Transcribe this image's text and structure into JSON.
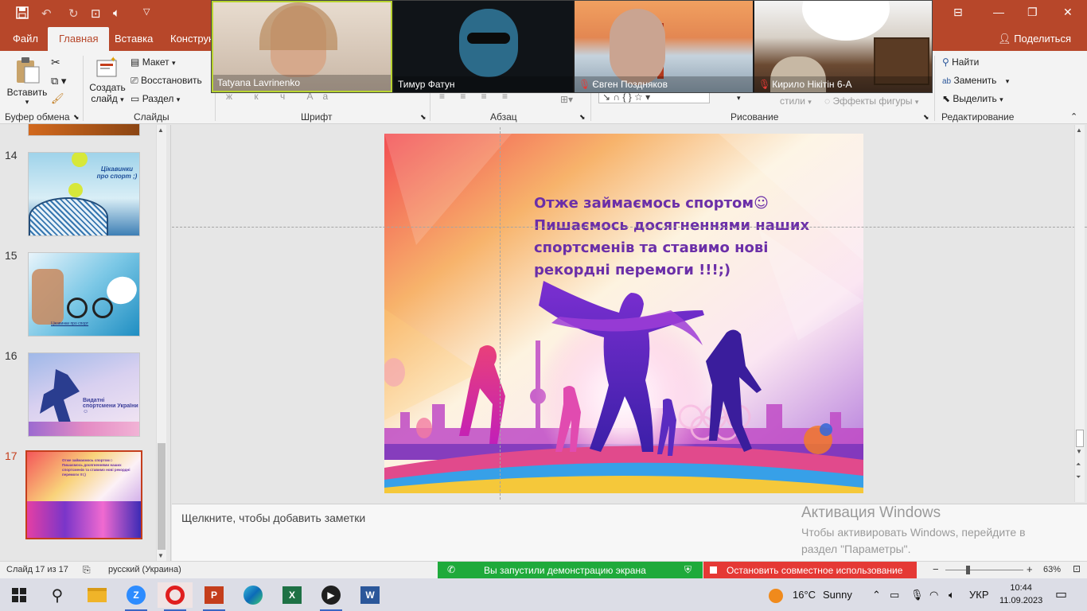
{
  "titlebar": {
    "quick_access": [
      "save-icon",
      "undo-icon",
      "redo-icon",
      "present-icon",
      "volume-icon",
      "customize-icon"
    ]
  },
  "tabs": [
    {
      "label": "Файл"
    },
    {
      "label": "Главная",
      "active": true
    },
    {
      "label": "Вставка"
    },
    {
      "label": "Конструк"
    }
  ],
  "share_label": "Поделиться",
  "ribbon": {
    "clipboard": {
      "paste": "Вставить",
      "label": "Буфер обмена"
    },
    "slides": {
      "new_slide_line1": "Создать",
      "new_slide_line2": "слайд",
      "layout": "Макет",
      "reset": "Восстановить",
      "section": "Раздел",
      "label": "Слайды"
    },
    "font": {
      "label": "Шрифт"
    },
    "paragraph": {
      "label": "Абзац"
    },
    "drawing": {
      "styles": "стили",
      "effects": "Эффекты фигуры",
      "label": "Рисование"
    },
    "editing": {
      "find": "Найти",
      "replace": "Заменить",
      "select": "Выделить",
      "label": "Редактирование"
    }
  },
  "participants": [
    {
      "name": "Tatyana Lavrinenko",
      "muted": false
    },
    {
      "name": "Тимур Фатун",
      "muted": false
    },
    {
      "name": "Євген Поздняков",
      "muted": true
    },
    {
      "name": "Кирило Нікітін 6-А",
      "muted": true
    }
  ],
  "thumbnails": [
    {
      "num": "14",
      "text": "Цікавинки про спорт ;)"
    },
    {
      "num": "15",
      "text": "Цікавинки про спорт"
    },
    {
      "num": "16",
      "text": "Видатні спортсмени України ☺"
    },
    {
      "num": "17",
      "text": "Отже займаємось спортом☺ Пишаємось досягненнями наших спортсменів та ставимо нові рекордні перемоги !!!;)",
      "selected": true
    }
  ],
  "slide": {
    "line1": "Отже займаємось спортом☺",
    "line2": "Пишаємось досягненнями наших",
    "line3": "спортсменів та ставимо нові",
    "line4": "рекордні перемоги !!!;)"
  },
  "notes_placeholder": "Щелкните, чтобы добавить заметки",
  "activation": {
    "title": "Активация Windows",
    "line1": "Чтобы активировать Windows, перейдите в",
    "line2": "раздел \"Параметры\"."
  },
  "status": {
    "slide_counter": "Слайд 17 из 17",
    "language": "русский (Украина)",
    "zoom": "63%"
  },
  "zoom_bar": {
    "sharing": "Вы запустили демонстрацию экрана",
    "stop": "Остановить совместное использование"
  },
  "taskbar": {
    "weather_temp": "16°C",
    "weather_text": "Sunny",
    "lang": "УКР",
    "time": "10:44",
    "date": "11.09.2023"
  },
  "colors": {
    "accent": "#b7472a",
    "slide_text": "#6b2fa8",
    "zoom_green": "#1faa3b",
    "zoom_red": "#e53935"
  }
}
